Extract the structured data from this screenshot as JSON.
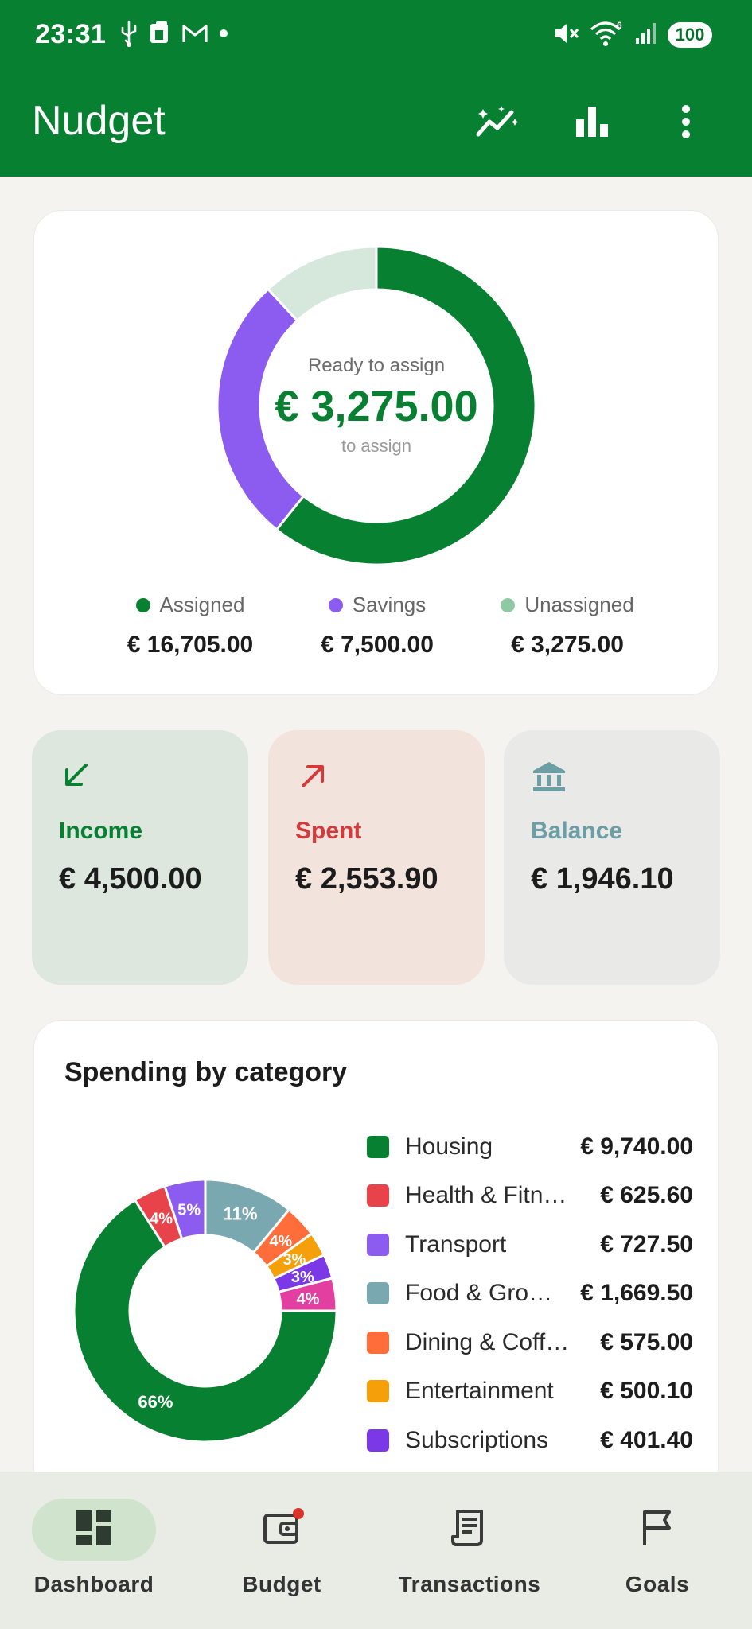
{
  "status_bar": {
    "time": "23:31",
    "battery": "100",
    "wifi_badge": "6"
  },
  "app_bar": {
    "title": "Nudget",
    "actions": [
      "insights-icon",
      "bar-chart-icon",
      "more-vert-icon"
    ]
  },
  "ready_card": {
    "label": "Ready to assign",
    "amount": "€ 3,275.00",
    "sub": "to assign",
    "legend": [
      {
        "name": "Assigned",
        "value": "€ 16,705.00",
        "color": "#078031",
        "amount": 16705.0
      },
      {
        "name": "Savings",
        "value": "€ 7,500.00",
        "color": "#8c5cf0",
        "amount": 7500.0
      },
      {
        "name": "Unassigned",
        "value": "€ 3,275.00",
        "color": "#8fc9a3",
        "amount": 3275.0
      }
    ],
    "ring_colors": [
      "#078031",
      "#8c5cf0",
      "#d6e8dc"
    ]
  },
  "tiles": {
    "income": {
      "label": "Income",
      "value": "€ 4,500.00",
      "color": "#078031",
      "icon": "arrow-down-left-icon"
    },
    "spent": {
      "label": "Spent",
      "value": "€ 2,553.90",
      "color": "#d33a3a",
      "icon": "arrow-up-right-icon"
    },
    "balance": {
      "label": "Balance",
      "value": "€ 1,946.10",
      "color": "#6c9ea6",
      "icon": "bank-icon"
    }
  },
  "spending": {
    "title": "Spending by category",
    "categories": [
      {
        "name": "Housing",
        "amount": "€ 9,740.00",
        "color": "#078031"
      },
      {
        "name": "Health & Fitn…",
        "amount": "€ 625.60",
        "color": "#e8424a"
      },
      {
        "name": "Transport",
        "amount": "€ 727.50",
        "color": "#8c5cf0"
      },
      {
        "name": "Food & Gro…",
        "amount": "€ 1,669.50",
        "color": "#79a8b0"
      },
      {
        "name": "Dining & Coff…",
        "amount": "€ 575.00",
        "color": "#ff6e3a"
      },
      {
        "name": "Entertainment",
        "amount": "€ 500.10",
        "color": "#f5a00a"
      },
      {
        "name": "Subscriptions",
        "amount": "€ 401.40",
        "color": "#7a38e6"
      }
    ]
  },
  "chart_data": {
    "type": "pie",
    "categories": [
      "Housing",
      "Health & Fitn…",
      "Transport",
      "Food & Gro…",
      "Dining & Coff…",
      "Entertainment",
      "Subscriptions",
      ""
    ],
    "values": [
      66,
      4,
      5,
      11,
      4,
      3,
      3,
      4
    ],
    "labels": [
      "66%",
      "4%",
      "5%",
      "11%",
      "4%",
      "3%",
      "3%",
      "4%"
    ],
    "colors": [
      "#078031",
      "#e8424a",
      "#8c5cf0",
      "#79a8b0",
      "#ff6e3a",
      "#f5a00a",
      "#7a38e6",
      "#e23fa0"
    ]
  },
  "bottom_nav": [
    {
      "label": "Dashboard",
      "icon": "dashboard-icon",
      "active": true
    },
    {
      "label": "Budget",
      "icon": "wallet-icon",
      "active": false,
      "badge": true
    },
    {
      "label": "Transactions",
      "icon": "receipt-icon",
      "active": false
    },
    {
      "label": "Goals",
      "icon": "flag-icon",
      "active": false
    }
  ]
}
